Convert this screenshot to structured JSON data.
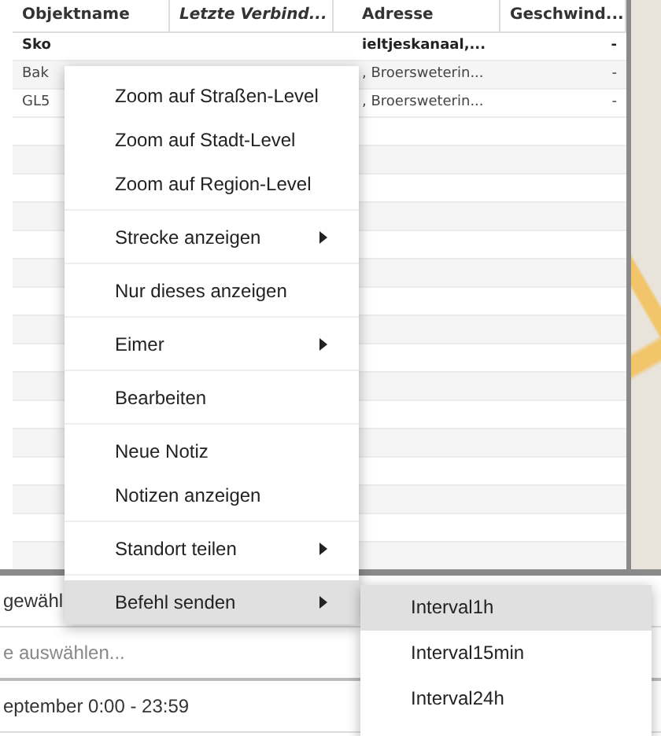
{
  "table": {
    "columns": [
      {
        "label": "Objektname",
        "italic": false
      },
      {
        "label": "Letzte Verbind...",
        "italic": true
      },
      {
        "label": "Adresse",
        "italic": false
      },
      {
        "label": "Geschwind...",
        "italic": false
      }
    ],
    "rows": [
      {
        "name": "Sko",
        "bold": true,
        "address": "ieltjeskanaal,...",
        "speed": "-"
      },
      {
        "name": "Bak",
        "bold": false,
        "address": ", Broersweterin...",
        "speed": "-"
      },
      {
        "name": "GL5",
        "bold": false,
        "address": ", Broersweterin...",
        "speed": "-"
      }
    ]
  },
  "bottom_panel": {
    "label": "gewähl",
    "placeholder": "e auswählen...",
    "period": "eptember 0:00 - 23:59"
  },
  "context_menu": {
    "groups": [
      [
        {
          "label": "Zoom auf Straßen-Level",
          "has_submenu": false,
          "highlighted": false
        },
        {
          "label": "Zoom auf Stadt-Level",
          "has_submenu": false,
          "highlighted": false
        },
        {
          "label": "Zoom auf Region-Level",
          "has_submenu": false,
          "highlighted": false
        }
      ],
      [
        {
          "label": "Strecke anzeigen",
          "has_submenu": true,
          "highlighted": false
        }
      ],
      [
        {
          "label": "Nur dieses anzeigen",
          "has_submenu": false,
          "highlighted": false
        }
      ],
      [
        {
          "label": "Eimer",
          "has_submenu": true,
          "highlighted": false
        }
      ],
      [
        {
          "label": "Bearbeiten",
          "has_submenu": false,
          "highlighted": false
        }
      ],
      [
        {
          "label": "Neue Notiz",
          "has_submenu": false,
          "highlighted": false
        },
        {
          "label": "Notizen anzeigen",
          "has_submenu": false,
          "highlighted": false
        }
      ],
      [
        {
          "label": "Standort teilen",
          "has_submenu": true,
          "highlighted": false
        }
      ],
      [
        {
          "label": "Befehl senden",
          "has_submenu": true,
          "highlighted": true
        }
      ]
    ]
  },
  "submenu": {
    "items": [
      {
        "label": "Interval1h",
        "highlighted": true
      },
      {
        "label": "Interval15min",
        "highlighted": false
      },
      {
        "label": "Interval24h",
        "highlighted": false
      }
    ]
  }
}
